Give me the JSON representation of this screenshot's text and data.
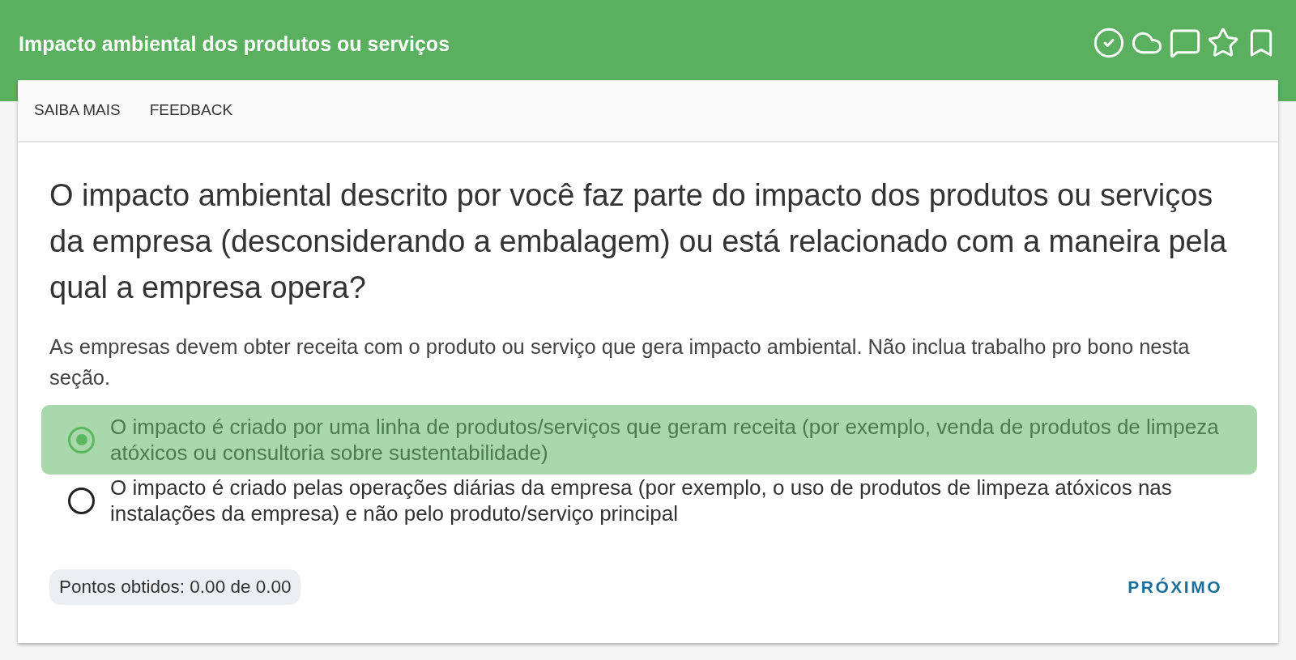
{
  "header": {
    "title": "Impacto ambiental dos produtos ou serviços"
  },
  "tabs": [
    {
      "label": "SAIBA MAIS"
    },
    {
      "label": "FEEDBACK"
    }
  ],
  "question": {
    "text": "O impacto ambiental descrito por você faz parte do impacto dos produtos ou serviços da empresa (desconsiderando a embalagem) ou está relacionado com a maneira pela qual a empresa opera?",
    "hint": "As empresas devem obter receita com o produto ou serviço que gera impacto ambiental. Não inclua trabalho pro bono nesta seção."
  },
  "options": [
    {
      "label": "O impacto é criado por uma linha de produtos/serviços que geram receita (por exemplo, venda de produtos de limpeza atóxicos ou consultoria sobre sustentabilidade)",
      "selected": true
    },
    {
      "label": "O impacto é criado pelas operações diárias da empresa (por exemplo, o uso de produtos de limpeza atóxicos nas instalações da empresa) e não pelo produto/serviço principal",
      "selected": false
    }
  ],
  "footer": {
    "score": "Pontos obtidos: 0.00 de 0.00",
    "next_button": "PRÓXIMO"
  }
}
